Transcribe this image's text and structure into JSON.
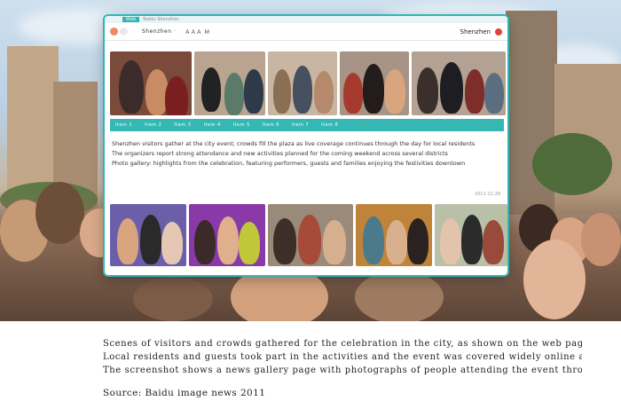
{
  "browser": {
    "tab_label": "Ｗeb",
    "tab_title": "Baidu Shenzhen",
    "address_text_1": "Shenzhen ·",
    "address_text_2": "ＡＡＡ Ｍ",
    "right_text": "Shenzhen"
  },
  "teal_bar": {
    "items": [
      "Item 1",
      "Item 2",
      "Item 3",
      "Item 4",
      "Item 5",
      "Item 6",
      "Item 7",
      "Item 8"
    ]
  },
  "article": {
    "lines": [
      "Shenzhen visitors gather at the city event; crowds fill the plaza as live coverage continues through the day for local residents",
      "The organizers report strong attendance and new activities planned for the coming weekend across several districts",
      "Photo gallery: highlights from the celebration, featuring performers, guests and families enjoying the festivities downtown"
    ],
    "meta": "2011-11-28"
  },
  "caption": {
    "lines": [
      "Scenes of visitors and crowds gathered for the celebration in the city, as shown on the web page captured above.",
      "Local residents and guests took part in the activities and the event was covered widely online and in print media.",
      "The screenshot shows a news gallery page with photographs of people attending the event throughout the day."
    ],
    "source_label": "Source: ",
    "source_text": "Baidu image news 2011"
  },
  "colors": {
    "accent": "#36b7b4",
    "border": "#2fb6b4"
  }
}
